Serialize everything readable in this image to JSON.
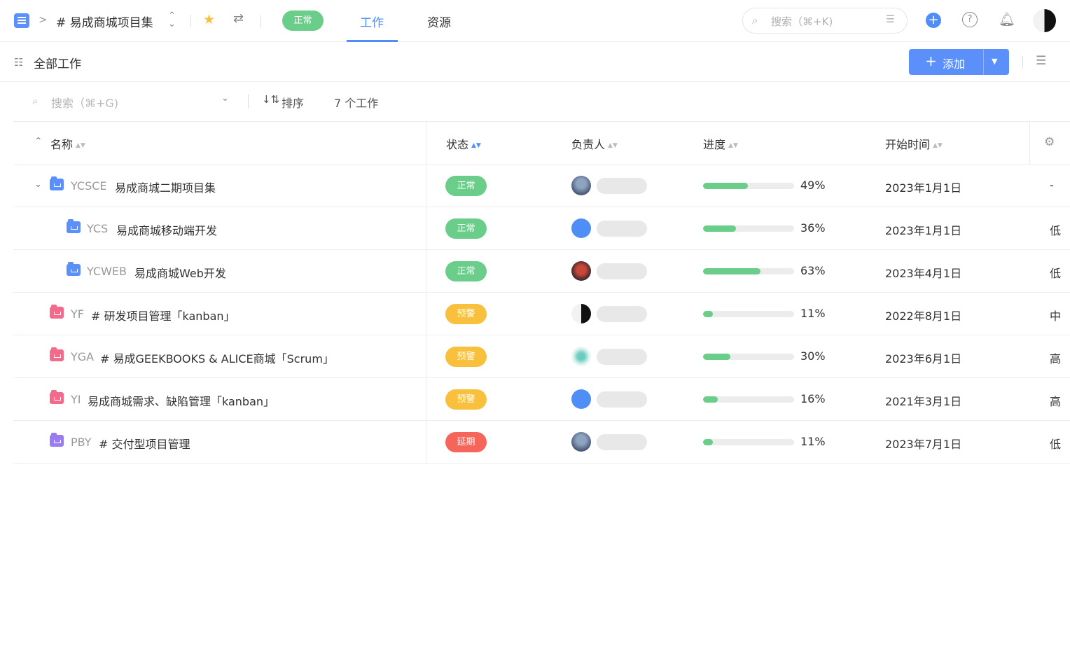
{
  "topbar": {
    "breadcrumb_sep": ">",
    "project_title": "# 易成商城项目集",
    "state_pill": "正常",
    "tabs": [
      {
        "label": "工作",
        "active": true
      },
      {
        "label": "资源",
        "active": false
      }
    ],
    "search_placeholder": "搜索（⌘+K)",
    "icons": [
      "app-icon",
      "switch-icon",
      "star-icon",
      "settings-icon",
      "filter-icon",
      "add-icon",
      "help-icon",
      "bell-icon",
      "avatar"
    ]
  },
  "subbar": {
    "view_title": "全部工作",
    "add_label": "添加",
    "add_plus": "+",
    "add_caret": "▼"
  },
  "toolbar": {
    "search_placeholder": "搜索（⌘+G)",
    "sort_label": "排序",
    "count_label": "7 个工作"
  },
  "columns": {
    "name": "名称",
    "state": "状态",
    "owner": "负责人",
    "progress": "进度",
    "start": "开始时间"
  },
  "colors": {
    "accent": "#4f8ef7",
    "normal": "#6bcd8a",
    "warning": "#f8c03d",
    "delayed": "#f5655a"
  },
  "rows": [
    {
      "code": "YCSCE",
      "name": "易成商城二期项目集",
      "state": "正常",
      "progress": 49,
      "progress_text": "49%",
      "start": "2023年1月1日",
      "priority": "-"
    },
    {
      "code": "YCS",
      "name": "易成商城移动端开发",
      "state": "正常",
      "progress": 36,
      "progress_text": "36%",
      "start": "2023年1月1日",
      "priority": "低"
    },
    {
      "code": "YCWEB",
      "name": "易成商城Web开发",
      "state": "正常",
      "progress": 63,
      "progress_text": "63%",
      "start": "2023年4月1日",
      "priority": "低"
    },
    {
      "code": "YF",
      "name": "# 研发项目管理「kanban」",
      "state": "预警",
      "progress": 11,
      "progress_text": "11%",
      "start": "2022年8月1日",
      "priority": "中"
    },
    {
      "code": "YGA",
      "name": "# 易成GEEKBOOKS & ALICE商城「Scrum」",
      "state": "预警",
      "progress": 30,
      "progress_text": "30%",
      "start": "2023年6月1日",
      "priority": "高"
    },
    {
      "code": "YI",
      "name": "易成商城需求、缺陷管理「kanban」",
      "state": "预警",
      "progress": 16,
      "progress_text": "16%",
      "start": "2021年3月1日",
      "priority": "高"
    },
    {
      "code": "PBY",
      "name": "# 交付型项目管理",
      "state": "延期",
      "progress": 11,
      "progress_text": "11%",
      "start": "2023年7月1日",
      "priority": "低"
    }
  ]
}
